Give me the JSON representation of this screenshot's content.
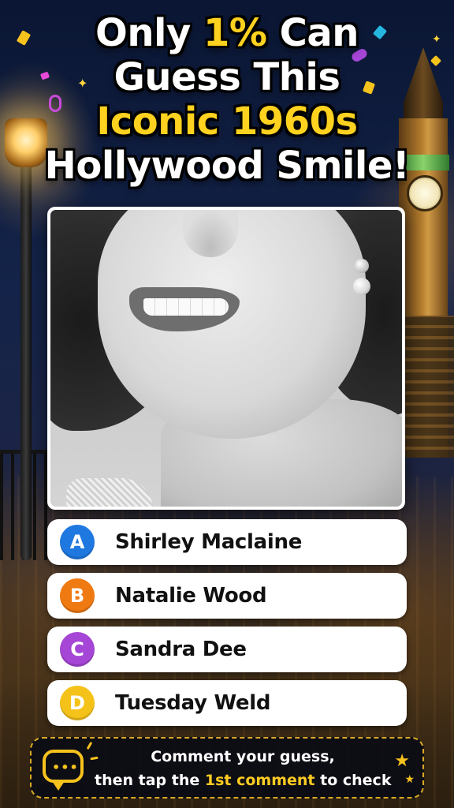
{
  "title": {
    "line1_pre": "Only ",
    "line1_highlight": "1%",
    "line1_post": " Can",
    "line2": "Guess This",
    "line3": "Iconic 1960s",
    "line4": "Hollywood Smile!"
  },
  "photo": {
    "description_icon": "smile-photo"
  },
  "options": [
    {
      "letter": "A",
      "text": "Shirley Maclaine",
      "color": "#1f78e0"
    },
    {
      "letter": "B",
      "text": "Natalie Wood",
      "color": "#f07a12"
    },
    {
      "letter": "C",
      "text": "Sandra Dee",
      "color": "#a646d6"
    },
    {
      "letter": "D",
      "text": "Tuesday Weld",
      "color": "#f5c21a"
    }
  ],
  "banner": {
    "line1": "Comment your guess,",
    "line2_pre": "then tap the ",
    "line2_highlight": "1st comment",
    "line2_post": " to check",
    "icon": "comment-bubble-icon"
  },
  "colors": {
    "accent": "#ffd21f",
    "banner_border": "#d9a826"
  }
}
